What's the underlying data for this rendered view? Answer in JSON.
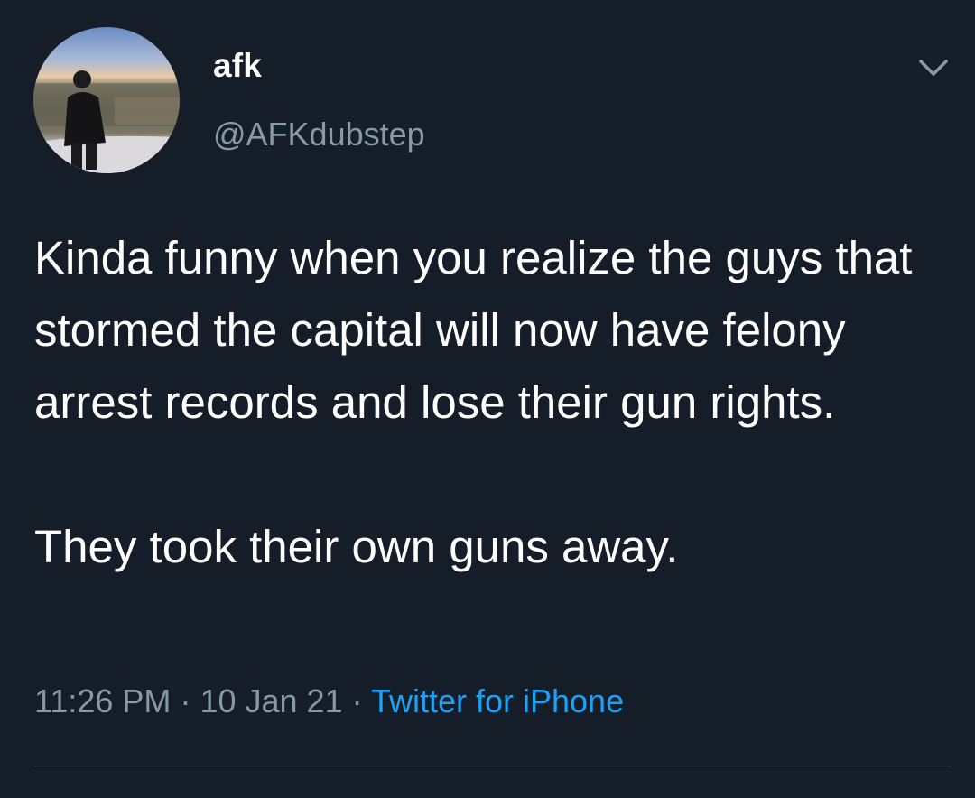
{
  "tweet": {
    "author": {
      "display_name": "afk",
      "handle": "@AFKdubstep",
      "avatar_icon": "profile-photo"
    },
    "body": [
      "Kinda funny when you realize the guys that stormed the capital will now have felony arrest records and lose their gun rights.",
      "They took their own guns away."
    ],
    "time": "11:26 PM",
    "date": "10 Jan 21",
    "separator": "·",
    "source": "Twitter for iPhone",
    "menu_icon": "chevron-down-icon"
  },
  "colors": {
    "background": "#151d28",
    "primary_text": "#ffffff",
    "secondary_text": "#8899a6",
    "link": "#1da1f2",
    "divider": "#38444d"
  }
}
